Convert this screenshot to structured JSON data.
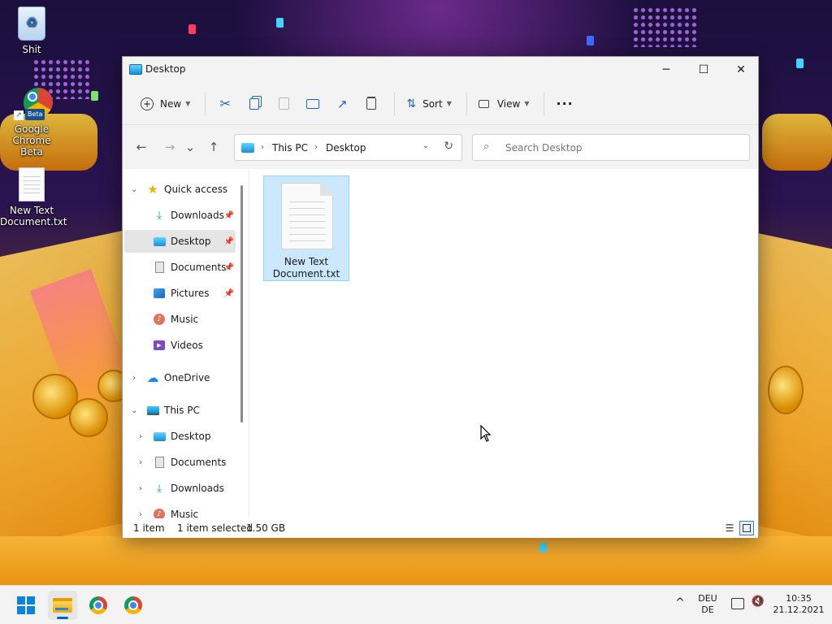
{
  "desktop": {
    "icons": [
      {
        "label": "Shit",
        "icon": "recycle-bin-icon"
      },
      {
        "label": "Google Chrome Beta",
        "icon": "chrome-beta-icon",
        "badge": "Beta"
      },
      {
        "label": "New Text Document.txt",
        "icon": "text-document-icon"
      }
    ]
  },
  "window": {
    "title": "Desktop",
    "controls": {
      "minimize": "─",
      "maximize": "☐",
      "close": "✕"
    }
  },
  "commandbar": {
    "new_label": "New",
    "sort_label": "Sort",
    "view_label": "View",
    "more_label": "···",
    "icons": [
      "cut-icon",
      "copy-icon",
      "paste-icon",
      "rename-icon",
      "share-icon",
      "delete-icon"
    ]
  },
  "navbar": {
    "back": "←",
    "forward": "→",
    "recent": "⌄",
    "up": "↑",
    "breadcrumb": [
      "This PC",
      "Desktop"
    ],
    "search_placeholder": "Search Desktop"
  },
  "navpane": {
    "quick_access_label": "Quick access",
    "quick_access_items": [
      {
        "label": "Downloads",
        "icon": "download-icon",
        "pinned": true
      },
      {
        "label": "Desktop",
        "icon": "desktop-folder-icon",
        "pinned": true,
        "selected": true
      },
      {
        "label": "Documents",
        "icon": "documents-icon",
        "pinned": true
      },
      {
        "label": "Pictures",
        "icon": "pictures-icon",
        "pinned": true
      },
      {
        "label": "Music",
        "icon": "music-icon",
        "pinned": false
      },
      {
        "label": "Videos",
        "icon": "videos-icon",
        "pinned": false
      }
    ],
    "onedrive_label": "OneDrive",
    "thispc_label": "This PC",
    "thispc_items": [
      {
        "label": "Desktop",
        "icon": "desktop-folder-icon"
      },
      {
        "label": "Documents",
        "icon": "documents-icon"
      },
      {
        "label": "Downloads",
        "icon": "download-icon"
      },
      {
        "label": "Music",
        "icon": "music-icon"
      }
    ]
  },
  "content": {
    "files": [
      {
        "name": "New Text Document.txt",
        "selected": true
      }
    ]
  },
  "statusbar": {
    "count": "1 item",
    "selected": "1 item selected",
    "size": "1.50 GB"
  },
  "taskbar": {
    "apps": [
      "start-icon",
      "file-explorer-icon",
      "chrome-icon",
      "chrome-beta-icon"
    ],
    "tray": {
      "chevron": "^",
      "lang_top": "DEU",
      "lang_bottom": "DE",
      "time": "10:35",
      "date": "21.12.2021"
    }
  },
  "colors": {
    "accent": "#0067c0",
    "selection": "#cce8ff",
    "chrome_bar": "#f3f3f3"
  }
}
